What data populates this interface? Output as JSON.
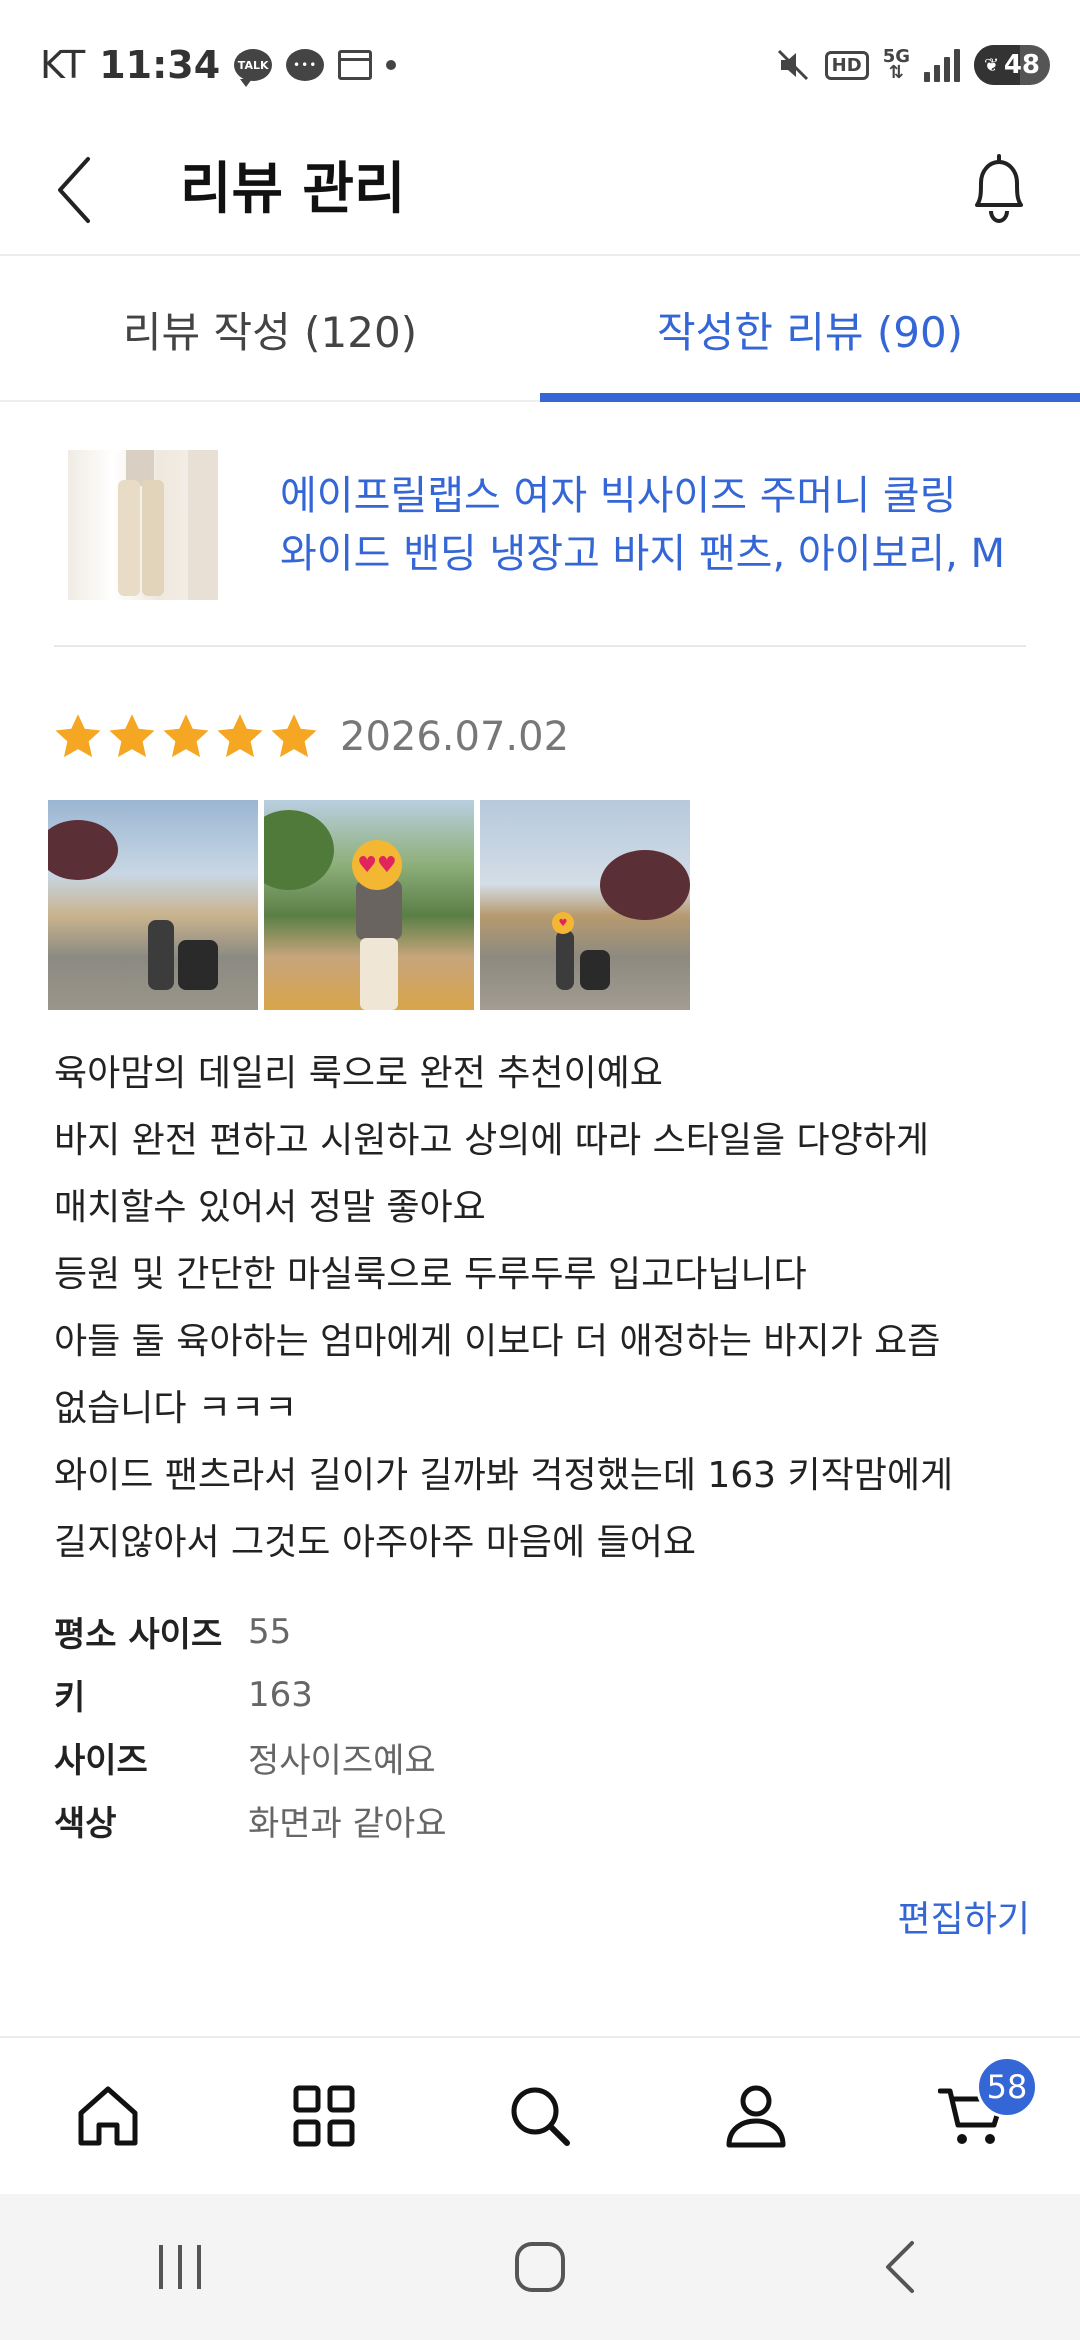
{
  "status_bar": {
    "carrier": "KT",
    "time": "11:34",
    "notif_icons": [
      "kakaotalk-icon",
      "chat-icon",
      "calendar-icon"
    ],
    "hd_label": "HD",
    "network_label": "5G",
    "battery": "48"
  },
  "header": {
    "title": "리뷰 관리"
  },
  "tabs": [
    {
      "label": "리뷰 작성 (120)",
      "active": false
    },
    {
      "label": "작성한 리뷰 (90)",
      "active": true
    }
  ],
  "product": {
    "name_line1": "에이프릴랩스 여자 빅사이즈 주머니 쿨링",
    "name_line2": "와이드 밴딩 냉장고 바지 팬츠, 아이보리, M"
  },
  "review": {
    "rating": 5,
    "date": "2026.07.02",
    "lines": [
      "육아맘의 데일리 룩으로 완전 추천이예요",
      "바지 완전 편하고 시원하고 상의에 따라 스타일을 다양하게",
      "매치할수 있어서 정말 좋아요",
      "등원 및 간단한 마실룩으로 두루두루 입고다닙니다",
      "아들 둘 육아하는 엄마에게 이보다 더 애정하는 바지가 요즘",
      "없습니다 ㅋㅋㅋ",
      "와이드 팬츠라서 길이가 길까봐 걱정했는데 163 키작맘에게",
      "길지않아서 그것도 아주아주 마음에 들어요"
    ],
    "attributes": [
      {
        "key": "평소 사이즈",
        "value": "55"
      },
      {
        "key": "키",
        "value": "163"
      },
      {
        "key": "사이즈",
        "value": "정사이즈예요"
      },
      {
        "key": "색상",
        "value": "화면과 같아요"
      }
    ],
    "edit_label": "편집하기"
  },
  "bottom_nav": {
    "items": [
      "home-icon",
      "category-icon",
      "search-icon",
      "profile-icon",
      "cart-icon"
    ],
    "cart_badge": "58"
  },
  "colors": {
    "accent": "#3466d6",
    "star": "#f5a623"
  }
}
